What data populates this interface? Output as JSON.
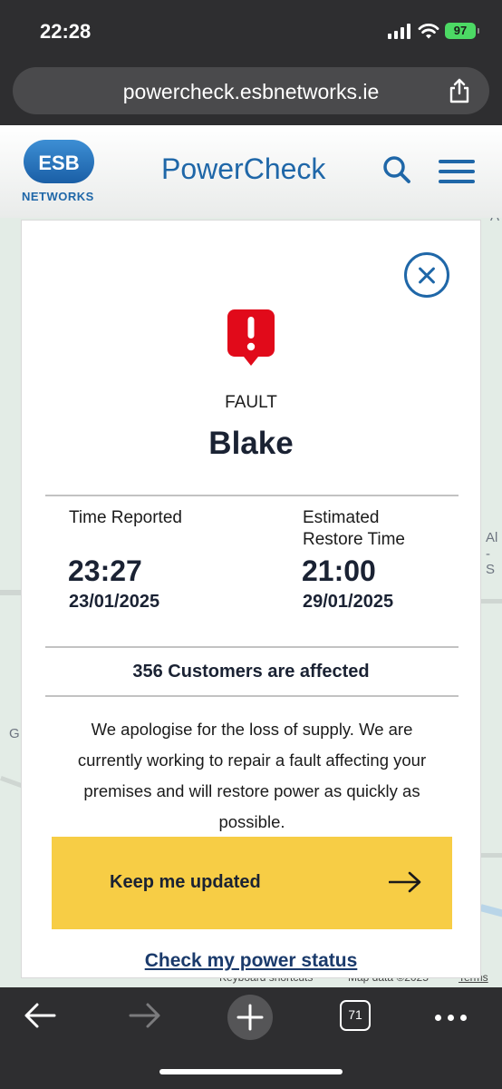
{
  "status_bar": {
    "time": "22:28",
    "battery": "97"
  },
  "browser": {
    "url": "powercheck.esbnetworks.ie",
    "tab_count": "71"
  },
  "header": {
    "logo_text": "ESB",
    "logo_subtitle": "NETWORKS",
    "brand": "PowerCheck"
  },
  "map": {
    "labels": [
      "A",
      "Al",
      "- S",
      "G"
    ],
    "footer": [
      "Keyboard shortcuts",
      "Map data ©2025",
      "Terms"
    ]
  },
  "fault": {
    "type": "FAULT",
    "area": "Blake",
    "time_reported_label": "Time Reported",
    "time_reported": "23:27",
    "date_reported": "23/01/2025",
    "restore_label_line1": "Estimated",
    "restore_label_line2": "Restore Time",
    "restore_time": "21:00",
    "restore_date": "29/01/2025",
    "affected": "356 Customers are affected",
    "message": "We apologise for the loss of supply. We are currently working to repair a fault affecting your premises and will restore power as quickly as possible.",
    "cta_label": "Keep me updated",
    "status_link": "Check my power status"
  },
  "colors": {
    "brand_blue": "#1f67a8",
    "cta_yellow": "#f7cd45",
    "fault_red": "#e10a1a",
    "battery_green": "#4cd964"
  }
}
